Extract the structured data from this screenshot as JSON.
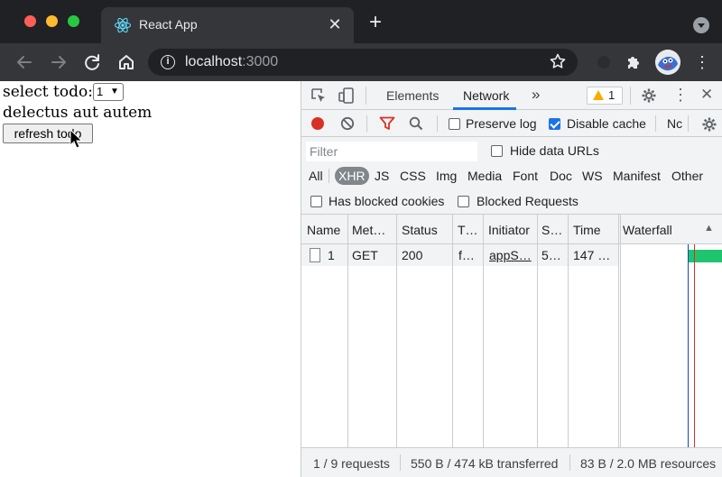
{
  "browser": {
    "tab_title": "React App",
    "tab_close": "✕",
    "new_tab": "+",
    "url_host": "localhost",
    "url_port": ":3000"
  },
  "page": {
    "select_label": "select todo:",
    "select_value": "1",
    "todo_title": "delectus aut autem",
    "refresh_label": "refresh todo"
  },
  "devtools": {
    "tabs": [
      {
        "label": "Elements"
      },
      {
        "label": "Network"
      },
      {
        "label": "»"
      }
    ],
    "warning_count": "1",
    "toolbar": {
      "preserve_log": "Preserve log",
      "preserve_log_checked": false,
      "disable_cache": "Disable cache",
      "disable_cache_checked": true,
      "throttle_truncated": "Nc"
    },
    "filter": {
      "placeholder": "Filter",
      "hide_data_urls": "Hide data URLs",
      "types": [
        "All",
        "XHR",
        "JS",
        "CSS",
        "Img",
        "Media",
        "Font",
        "Doc",
        "WS",
        "Manifest",
        "Other"
      ],
      "active_type": "XHR",
      "has_blocked_cookies": "Has blocked cookies",
      "blocked_requests": "Blocked Requests"
    },
    "columns": [
      "Name",
      "Met…",
      "Status",
      "T…",
      "Initiator",
      "S…",
      "Time",
      "Waterfall"
    ],
    "sort_indicator": "▲",
    "rows": [
      {
        "name": "1",
        "method": "GET",
        "status": "200",
        "type": "f…",
        "initiator": "appS…",
        "size": "5…",
        "time": "147 …"
      }
    ],
    "status": {
      "requests": "1 / 9 requests",
      "transferred": "550 B / 474 kB transferred",
      "resources": "83 B / 2.0 MB resources"
    }
  }
}
